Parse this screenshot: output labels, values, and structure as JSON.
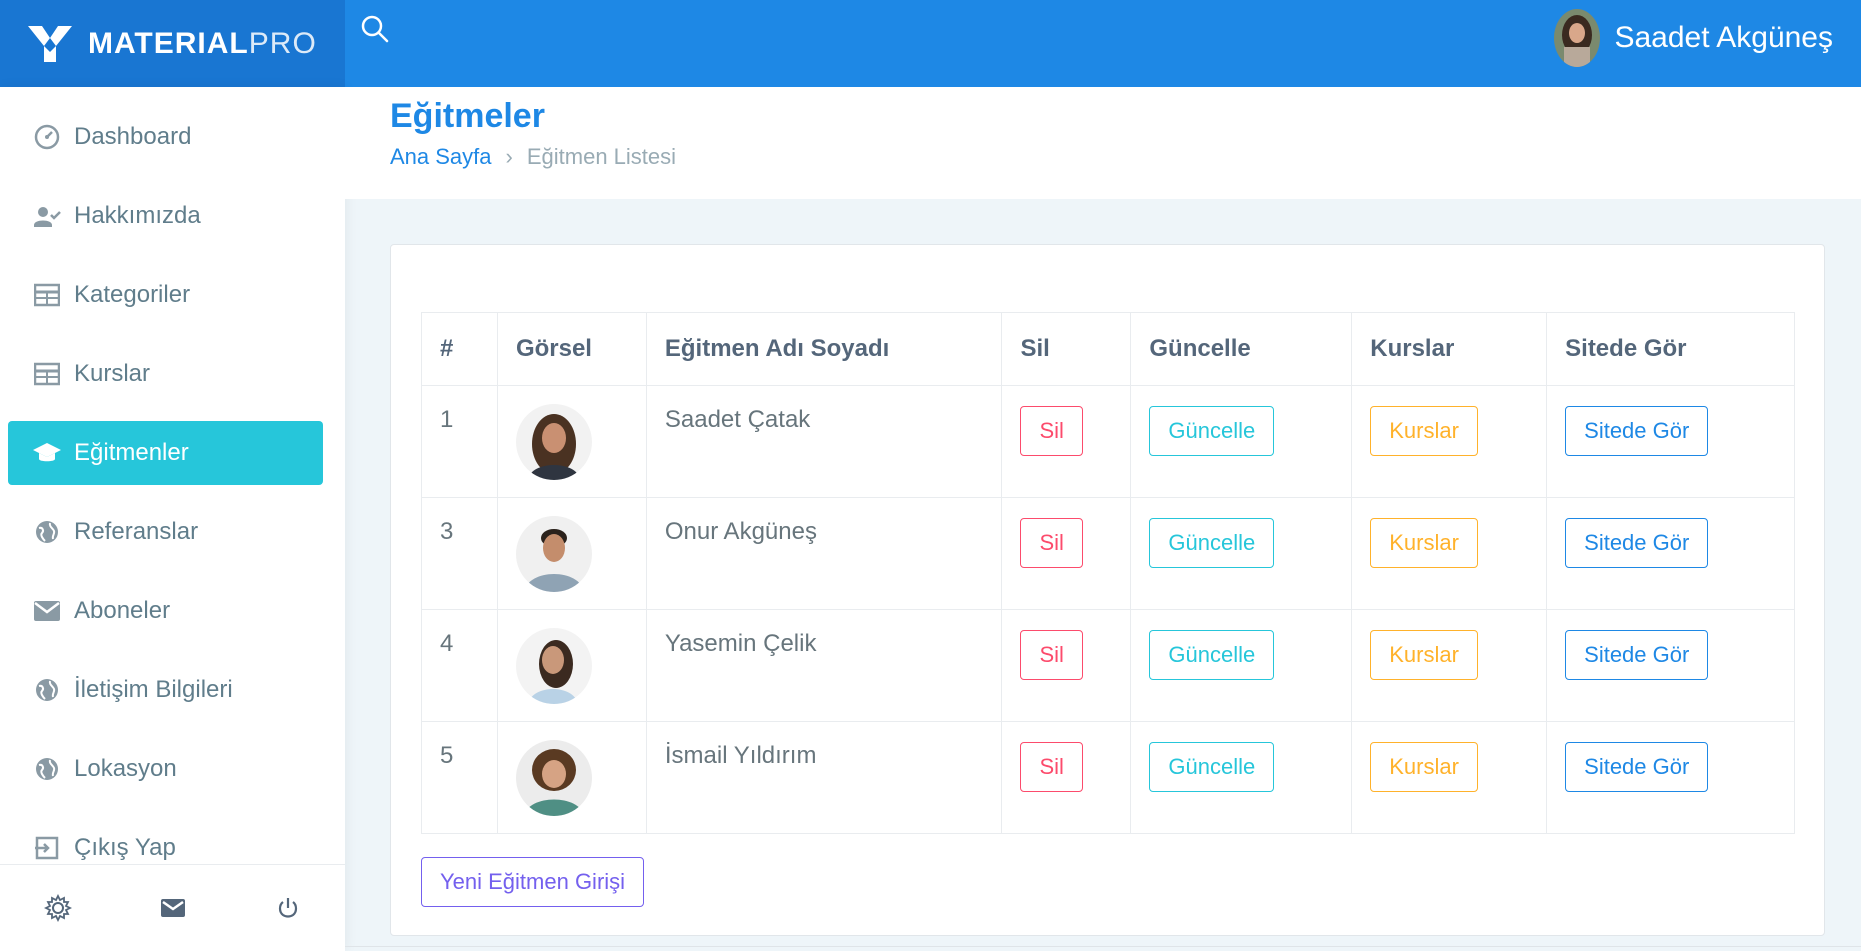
{
  "header": {
    "logo_bold": "MATERIAL",
    "logo_light": "PRO",
    "user_name": "Saadet Akgüneş"
  },
  "sidebar": {
    "items": [
      {
        "label": "Dashboard",
        "icon": "gauge-icon"
      },
      {
        "label": "Hakkımızda",
        "icon": "user-check-icon"
      },
      {
        "label": "Kategoriler",
        "icon": "table-icon"
      },
      {
        "label": "Kurslar",
        "icon": "table-icon"
      },
      {
        "label": "Eğitmenler",
        "icon": "graduation-cap-icon",
        "active": true
      },
      {
        "label": "Referanslar",
        "icon": "globe-icon"
      },
      {
        "label": "Aboneler",
        "icon": "mail-icon"
      },
      {
        "label": "İletişim Bilgileri",
        "icon": "globe-icon"
      },
      {
        "label": "Lokasyon",
        "icon": "globe-icon"
      },
      {
        "label": "Çıkış Yap",
        "icon": "logout-icon"
      }
    ],
    "footer": [
      "gear-icon",
      "mail-icon",
      "power-icon"
    ]
  },
  "page": {
    "title": "Eğitmeler",
    "breadcrumb_home": "Ana Sayfa",
    "breadcrumb_current": "Eğitmen Listesi"
  },
  "table": {
    "headers": [
      "#",
      "Görsel",
      "Eğitmen Adı Soyadı",
      "Sil",
      "Güncelle",
      "Kurslar",
      "Sitede Gör"
    ],
    "rows": [
      {
        "id": "1",
        "name": "Saadet Çatak",
        "delete": "Sil",
        "update": "Güncelle",
        "courses": "Kurslar",
        "view": "Sitede Gör"
      },
      {
        "id": "3",
        "name": "Onur Akgüneş",
        "delete": "Sil",
        "update": "Güncelle",
        "courses": "Kurslar",
        "view": "Sitede Gör"
      },
      {
        "id": "4",
        "name": "Yasemin Çelik",
        "delete": "Sil",
        "update": "Güncelle",
        "courses": "Kurslar",
        "view": "Sitede Gör"
      },
      {
        "id": "5",
        "name": "İsmail Yıldırım",
        "delete": "Sil",
        "update": "Güncelle",
        "courses": "Kurslar",
        "view": "Sitede Gör"
      }
    ]
  },
  "actions": {
    "new_trainer": "Yeni Eğitmen Girişi"
  },
  "colors": {
    "primary": "#1e88e5",
    "active": "#26c6da",
    "danger": "#fc4b6c",
    "warning": "#ffb22b",
    "purple": "#7460ee"
  }
}
